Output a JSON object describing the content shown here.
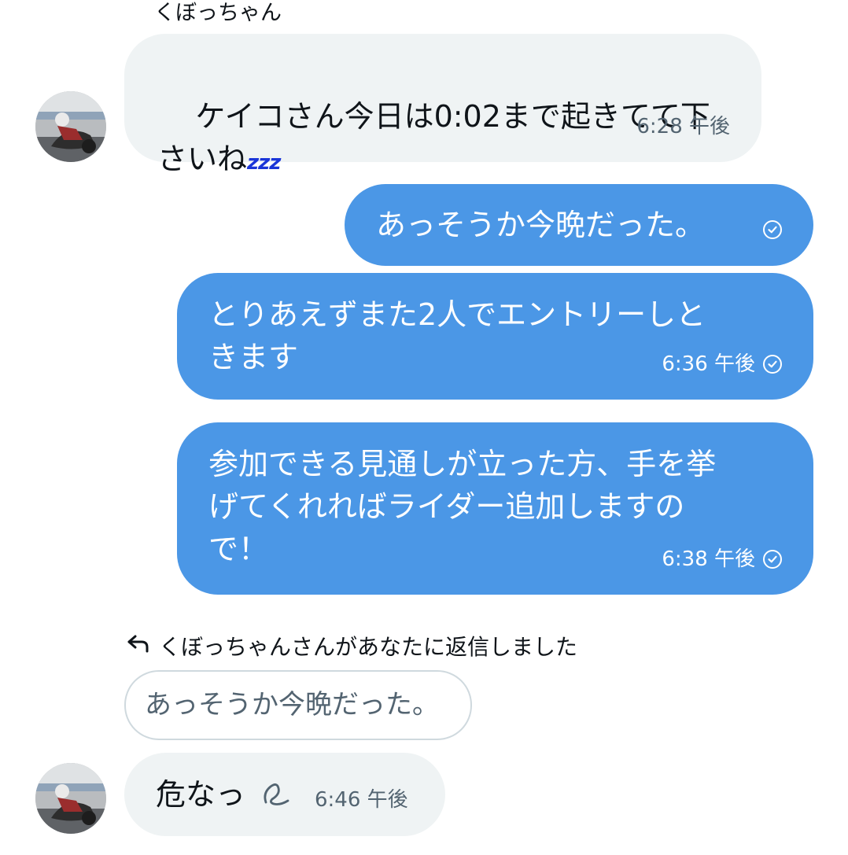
{
  "conversation": {
    "sender_name": "くぼっちゃん",
    "messages": [
      {
        "direction": "incoming",
        "text": "ケイコさん今日は0:02まで起きてて下\nさいね",
        "emoji": "zzz",
        "time": "6:28 午後"
      },
      {
        "direction": "outgoing",
        "text": "あっそうか今晩だった。",
        "time": "",
        "status": "sent-check-icon"
      },
      {
        "direction": "outgoing",
        "text": "とりあえずまた2人でエントリーしと\nきます",
        "time": "6:36 午後",
        "status": "sent-check-icon"
      },
      {
        "direction": "outgoing",
        "text": "参加できる見通しが立った方、手を挙\nげてくれればライダー追加しますの\nで！",
        "time": "6:38 午後",
        "status": "sent-check-icon"
      }
    ],
    "reply": {
      "label": "くぼっちゃんさんがあなたに返信しました",
      "quoted_text": "あっそうか今晩だった。",
      "text": "危なっ",
      "time": "6:46 午後",
      "icon": "edited-squiggle-icon"
    }
  },
  "colors": {
    "outgoing_bubble": "#4b97e6",
    "incoming_bubble": "#eff3f4",
    "zzz_emoji": "#1a35d8"
  }
}
